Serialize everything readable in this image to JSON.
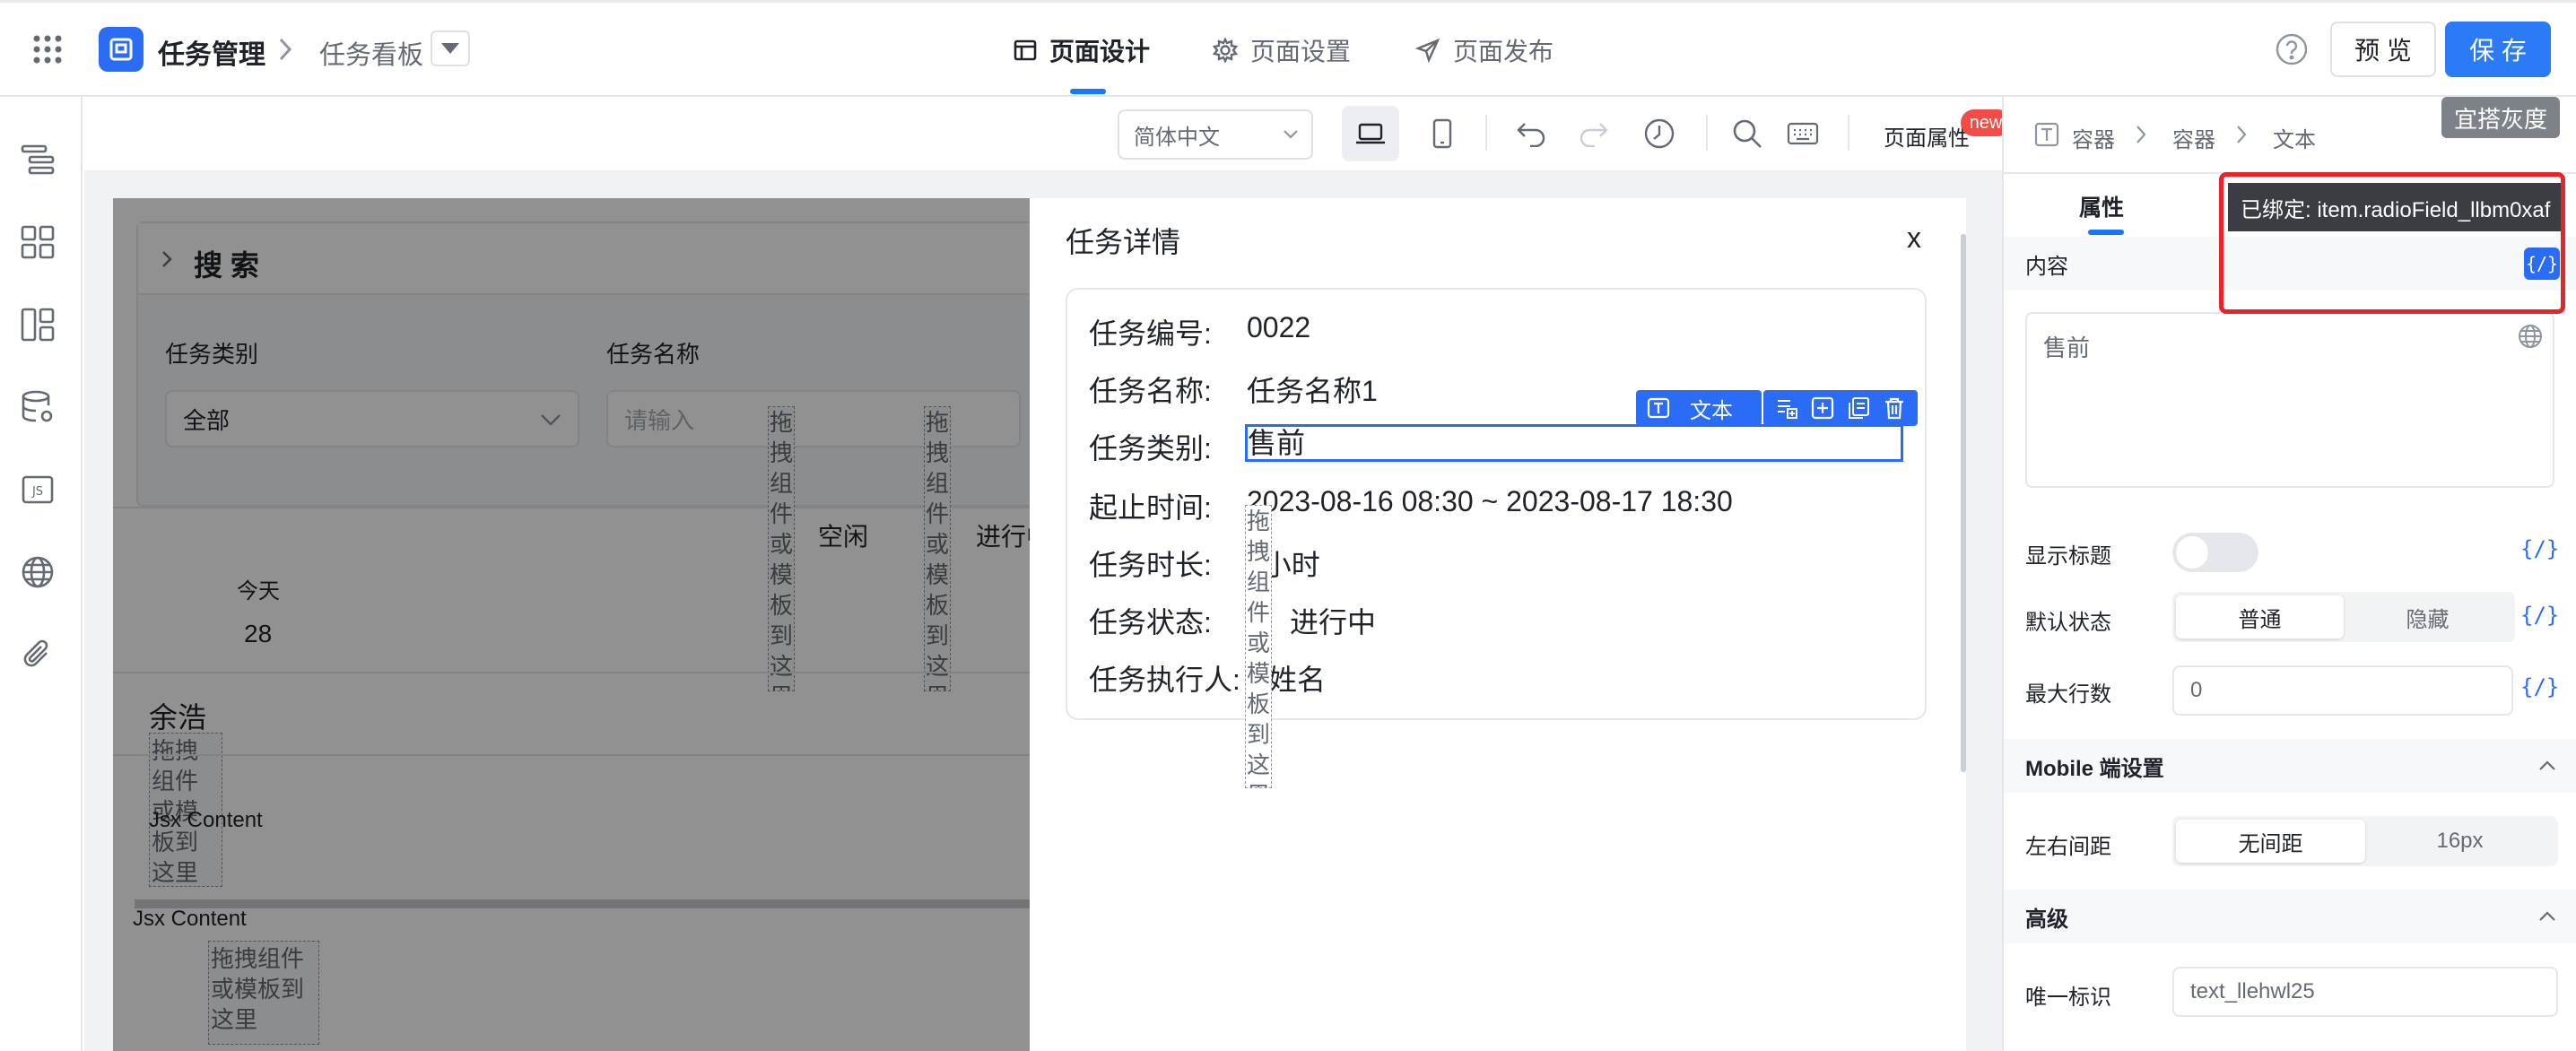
{
  "header": {
    "app_name": "任务管理",
    "breadcrumb_page": "任务看板",
    "tabs": [
      {
        "label": "页面设计",
        "icon": "layout-icon",
        "active": true
      },
      {
        "label": "页面设置",
        "icon": "gear-icon",
        "active": false
      },
      {
        "label": "页面发布",
        "icon": "send-icon",
        "active": false
      }
    ],
    "preview_label": "预 览",
    "save_label": "保 存",
    "gray_badge": "宜搭灰度",
    "accent_color": "#1677ff"
  },
  "toolbar": {
    "language": "简体中文",
    "page_props_label": "页面属性",
    "new_badge": "new"
  },
  "canvas": {
    "search_title": "搜 索",
    "filter_label_1": "任务类别",
    "filter_value_1": "全部",
    "filter_label_2": "任务名称",
    "filter_placeholder_2": "请输入",
    "drop_vertical": "拖拽组件或模板到这里",
    "col_idle": "空闲",
    "col_progress": "进行中",
    "today_label": "今天",
    "today_value": "28",
    "user_name": "余浩",
    "drop_small": "拖拽组件或模板到这里",
    "jsx_1": "Jsx Content",
    "jsx_2": "Jsx Content",
    "drop_bottom": "拖拽组件或模板到这里"
  },
  "drawer": {
    "title": "任务详情",
    "close": "x",
    "rows": [
      {
        "label": "任务编号:",
        "value": "0022"
      },
      {
        "label": "任务名称:",
        "value": "任务名称1"
      },
      {
        "label": "任务类别:",
        "value": "售前"
      },
      {
        "label": "起止时间:",
        "value": "2023-08-16 08:30 ~ 2023-08-17 18:30"
      },
      {
        "label": "任务时长:",
        "value": "3小时"
      },
      {
        "label": "任务状态:",
        "value": "进行中"
      },
      {
        "label": "任务执行人:",
        "value": "姓名"
      }
    ],
    "selected_tag": "文本",
    "drop_vertical": "拖拽组件或模板到这里"
  },
  "panel": {
    "breadcrumb": [
      "容器",
      "容器",
      "文本"
    ],
    "tab_props": "属性",
    "tooltip": "已绑定: item.radioField_llbm0xaf",
    "content_label": "内容",
    "content_value": "售前",
    "bind_glyph": "{/}",
    "show_title_label": "显示标题",
    "default_state_label": "默认状态",
    "state_options": [
      "普通",
      "隐藏"
    ],
    "max_rows_label": "最大行数",
    "max_rows_value": "0",
    "mobile_section": "Mobile 端设置",
    "margin_label": "左右间距",
    "margin_options": [
      "无间距",
      "16px"
    ],
    "advanced_section": "高级",
    "unique_id_label": "唯一标识",
    "unique_id_value": "text_llehwl25",
    "highlight_color": "#e5252a"
  }
}
